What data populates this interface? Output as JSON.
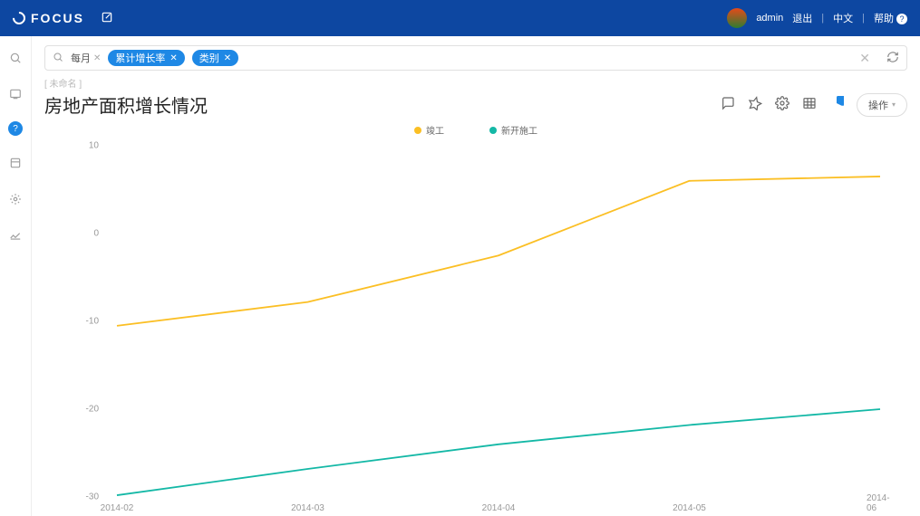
{
  "header": {
    "brand": "FOCUS",
    "user": "admin",
    "logout": "退出",
    "lang": "中文",
    "help": "帮助"
  },
  "search": {
    "plain_chip": "每月",
    "chips": [
      "累计增长率",
      "类别"
    ]
  },
  "breadcrumb": "[ 未命名 ]",
  "title": "房地产面积增长情况",
  "action_button": "操作",
  "chart_data": {
    "type": "line",
    "categories": [
      "2014-02",
      "2014-03",
      "2014-04",
      "2014-05",
      "2014-06"
    ],
    "series": [
      {
        "name": "竣工",
        "color": "#fbbf24",
        "values": [
          -10.5,
          -7.8,
          -2.5,
          6.0,
          6.5
        ]
      },
      {
        "name": "新开施工",
        "color": "#14b8a6",
        "values": [
          -29.8,
          -26.8,
          -24.0,
          -21.8,
          -20.0
        ]
      }
    ],
    "ylim": [
      -30,
      10
    ],
    "yticks": [
      10,
      0,
      -10,
      -20,
      -30
    ],
    "grid": false
  }
}
